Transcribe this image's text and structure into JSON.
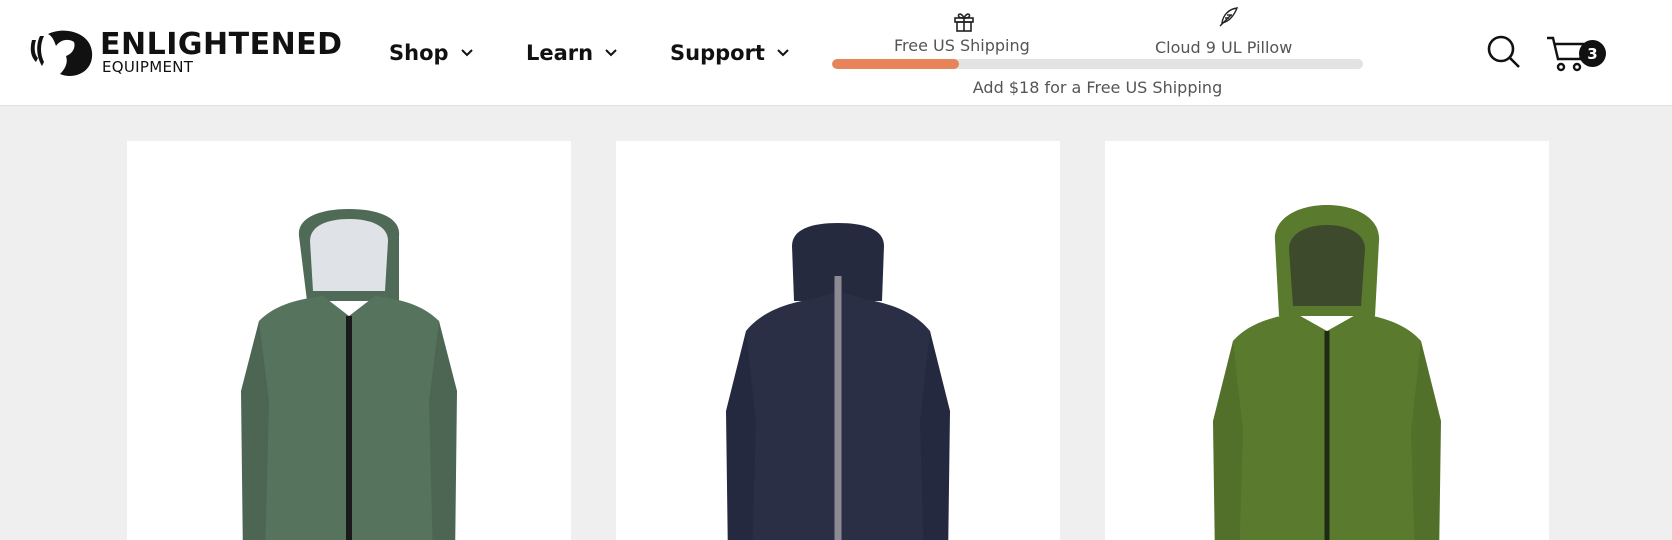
{
  "brand": {
    "name": "ENLIGHTENED",
    "subname": "EQUIPMENT"
  },
  "nav": {
    "items": [
      {
        "label": "Shop"
      },
      {
        "label": "Learn"
      },
      {
        "label": "Support"
      }
    ]
  },
  "promo": {
    "milestone_1": {
      "label": "Free US Shipping",
      "icon": "gift-icon"
    },
    "milestone_2": {
      "label": "Cloud 9 UL Pillow",
      "icon": "feather-icon"
    },
    "progress_fraction": 0.24,
    "progress_color": "#e8845a",
    "message": "Add $18 for a Free US Shipping"
  },
  "cart": {
    "count": "3"
  },
  "products": [
    {
      "image": "green-rain-jacket",
      "color": "#56735e"
    },
    {
      "image": "navy-insulated-jacket",
      "color": "#2b2f45"
    },
    {
      "image": "olive-puffy-jacket",
      "color": "#5a7a2e"
    }
  ]
}
